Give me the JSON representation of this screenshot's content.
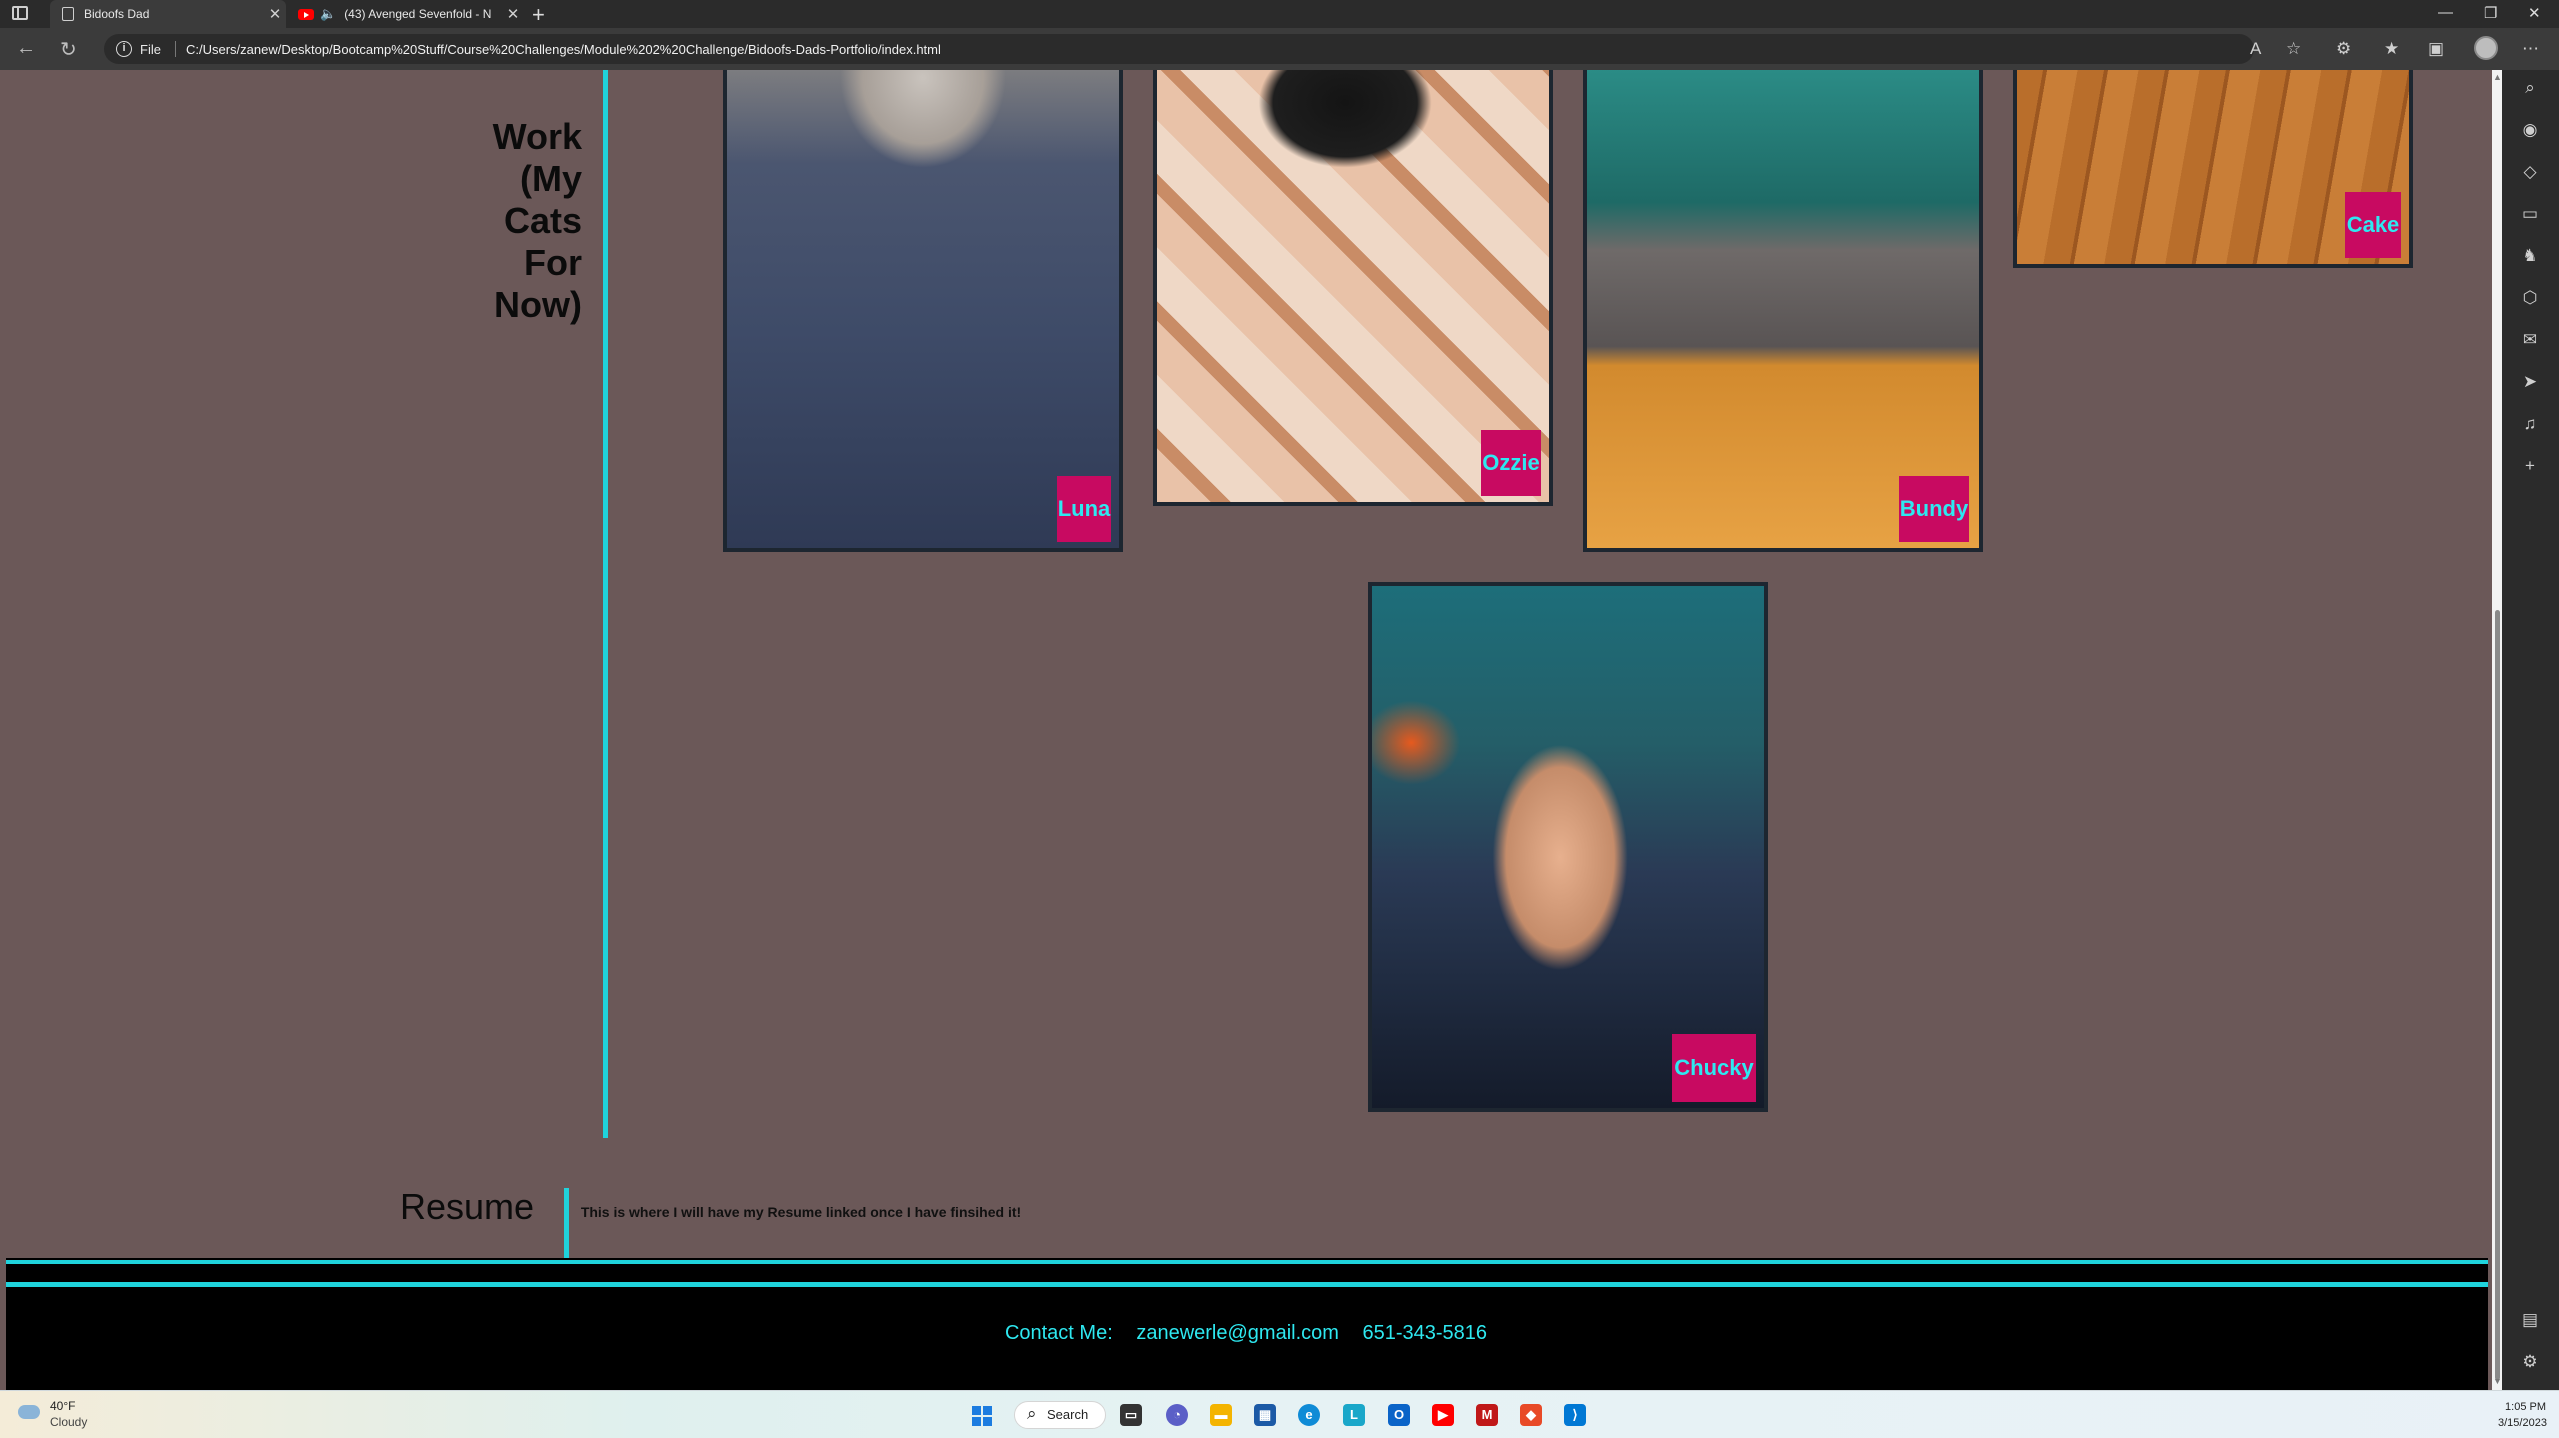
{
  "browser": {
    "tabs": [
      {
        "label": "Bidoofs Dad",
        "active": true
      },
      {
        "label": "(43) Avenged Sevenfold - N",
        "active": false
      }
    ],
    "address": {
      "scheme_label": "File",
      "url": "C:/Users/zanew/Desktop/Bootcamp%20Stuff/Course%20Challenges/Module%202%20Challenge/Bidoofs-Dads-Portfolio/index.html"
    }
  },
  "page": {
    "work_heading": "Work (My Cats For Now)",
    "cats": [
      {
        "name": "Luna"
      },
      {
        "name": "Ozzie"
      },
      {
        "name": "Bundy"
      },
      {
        "name": "Cake"
      },
      {
        "name": "Chucky"
      }
    ],
    "resume": {
      "heading": "Resume",
      "text": "This is where I will have my Resume linked once I have finsihed it!"
    },
    "footer": {
      "contact_label": "Contact Me:",
      "email": "zanewerle@gmail.com",
      "phone": "651-343-5816"
    },
    "colors": {
      "page_bg": "#6b5858",
      "accent_cyan": "#1fd3dc",
      "label_bg": "#c80a61",
      "label_text": "#2ee8f0"
    }
  },
  "taskbar": {
    "weather": {
      "temp": "40°F",
      "condition": "Cloudy"
    },
    "search_label": "Search",
    "time": "1:05 PM",
    "date": "3/15/2023"
  }
}
